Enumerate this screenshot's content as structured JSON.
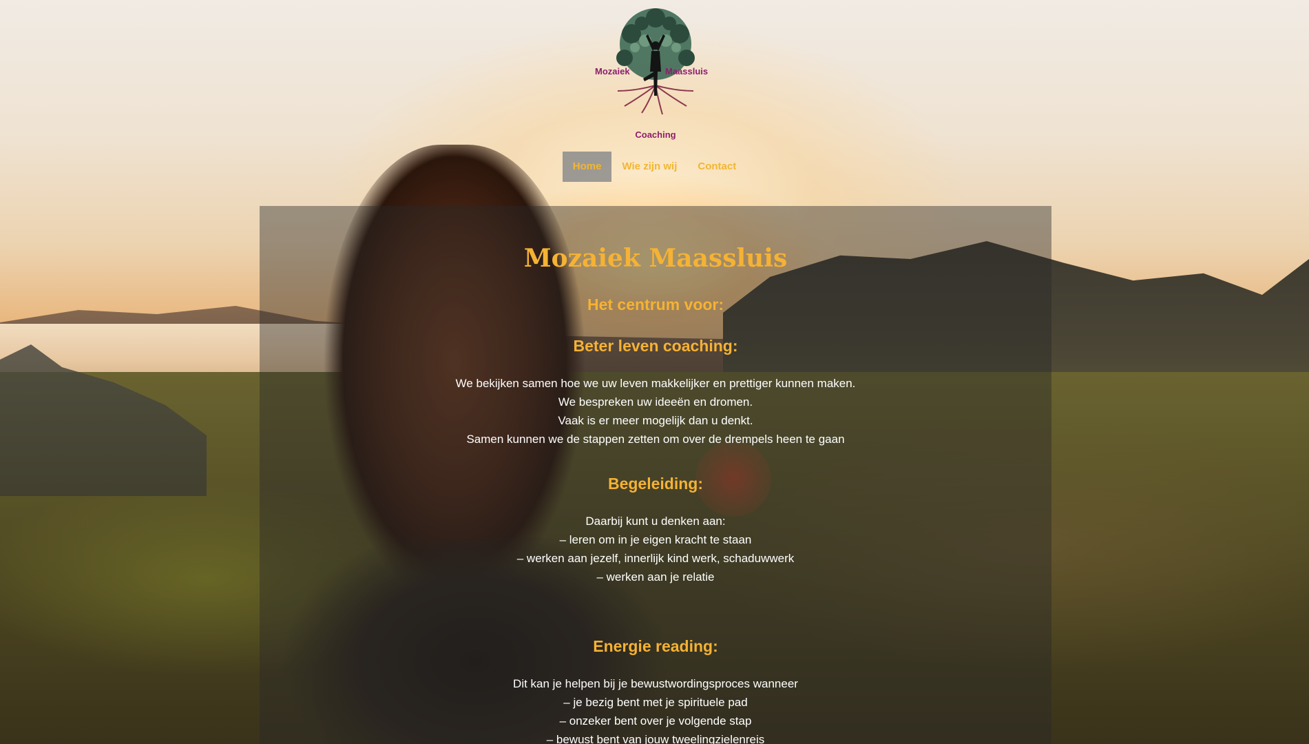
{
  "logo": {
    "word_left": "Mozaiek",
    "word_right": "Maassluis",
    "word_bottom": "Coaching"
  },
  "nav": {
    "items": [
      {
        "label": "Home",
        "active": true
      },
      {
        "label": "Wie zijn wij",
        "active": false
      },
      {
        "label": "Contact",
        "active": false
      }
    ]
  },
  "content": {
    "title": "Mozaiek Maassluis",
    "subtitle": "Het centrum voor:",
    "sections": [
      {
        "heading": "Beter leven coaching:",
        "lines": [
          "We bekijken samen hoe we uw leven makkelijker en prettiger kunnen maken.",
          "We bespreken uw ideeën en dromen.",
          "Vaak is er meer mogelijk dan u denkt.",
          "Samen kunnen we de stappen zetten om over de drempels heen te gaan"
        ]
      },
      {
        "heading": "Begeleiding:",
        "lines": [
          "Daarbij kunt u denken aan:",
          "– leren om in je eigen kracht te staan",
          "– werken aan jezelf, innerlijk kind werk, schaduwwerk",
          "– werken aan je relatie"
        ]
      },
      {
        "heading": "Energie reading:",
        "lines": [
          "Dit kan je helpen bij je bewustwordingsproces wanneer",
          "– je bezig bent met je spirituele pad",
          "– onzeker bent over je volgende stap",
          "– bewust bent van jouw tweelingzielenreis"
        ]
      }
    ]
  },
  "colors": {
    "accent": "#f5b234",
    "nav_active_bg": "#8c8c8c",
    "logo_text": "#8b1f6b",
    "panel_bg": "rgba(40,40,40,0.42)"
  }
}
